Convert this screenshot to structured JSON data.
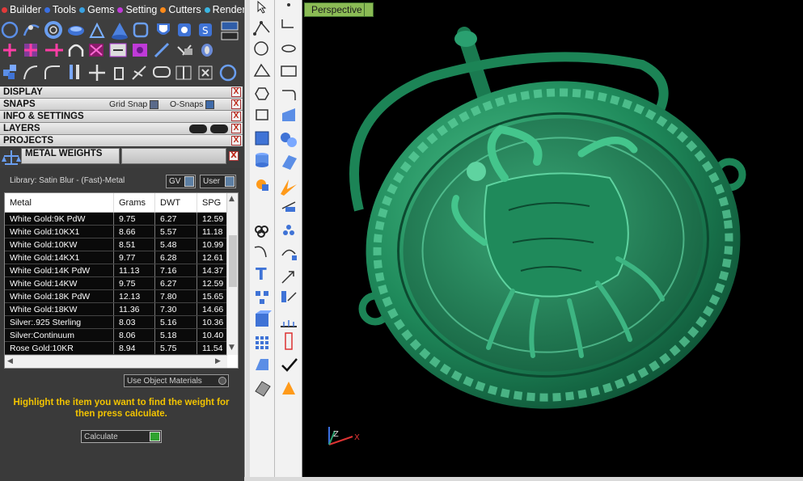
{
  "menu": [
    {
      "label": "Builder",
      "dot": "#e23a3a"
    },
    {
      "label": "Tools",
      "dot": "#3a6fe2"
    },
    {
      "label": "Gems",
      "dot": "#3aa2e2"
    },
    {
      "label": "Setting",
      "dot": "#c03ad8"
    },
    {
      "label": "Cutters",
      "dot": "#ff8a1a"
    },
    {
      "label": "Render",
      "dot": "#3ab5e2"
    }
  ],
  "sections": {
    "display": "DISPLAY",
    "snaps": "SNAPS",
    "grid_snap": "Grid Snap",
    "o_snaps": "O-Snaps",
    "info_settings": "INFO & SETTINGS",
    "layers": "LAYERS",
    "projects": "PROJECTS",
    "close": "X"
  },
  "metal_weights": {
    "title": "METAL WEIGHTS",
    "library": "Library: Satin Blur - (Fast)-Metal",
    "gv": "GV",
    "user": "User",
    "columns": [
      "Metal",
      "Grams",
      "DWT",
      "SPG"
    ],
    "rows": [
      [
        "White Gold:9K PdW",
        "9.75",
        "6.27",
        "12.59"
      ],
      [
        "White Gold:10KX1",
        "8.66",
        "5.57",
        "11.18"
      ],
      [
        "White Gold:10KW",
        "8.51",
        "5.48",
        "10.99"
      ],
      [
        "White Gold:14KX1",
        "9.77",
        "6.28",
        "12.61"
      ],
      [
        "White Gold:14K PdW",
        "11.13",
        "7.16",
        "14.37"
      ],
      [
        "White Gold:14KW",
        "9.75",
        "6.27",
        "12.59"
      ],
      [
        "White Gold:18K PdW",
        "12.13",
        "7.80",
        "15.65"
      ],
      [
        "White Gold:18KW",
        "11.36",
        "7.30",
        "14.66"
      ],
      [
        "Silver:.925 Sterling",
        "8.03",
        "5.16",
        "10.36"
      ],
      [
        "Silver:Continuum",
        "8.06",
        "5.18",
        "10.40"
      ],
      [
        "Rose Gold:10KR",
        "8.94",
        "5.75",
        "11.54"
      ]
    ],
    "use_object_materials": "Use Object Materials",
    "hint": "Highlight the item you want to find the weight for then press calculate.",
    "calculate": "Calculate"
  },
  "viewport": {
    "view_name": "Perspective",
    "model_color": "#1f8a5b",
    "axis_z": "Z",
    "axis_x": "X"
  }
}
